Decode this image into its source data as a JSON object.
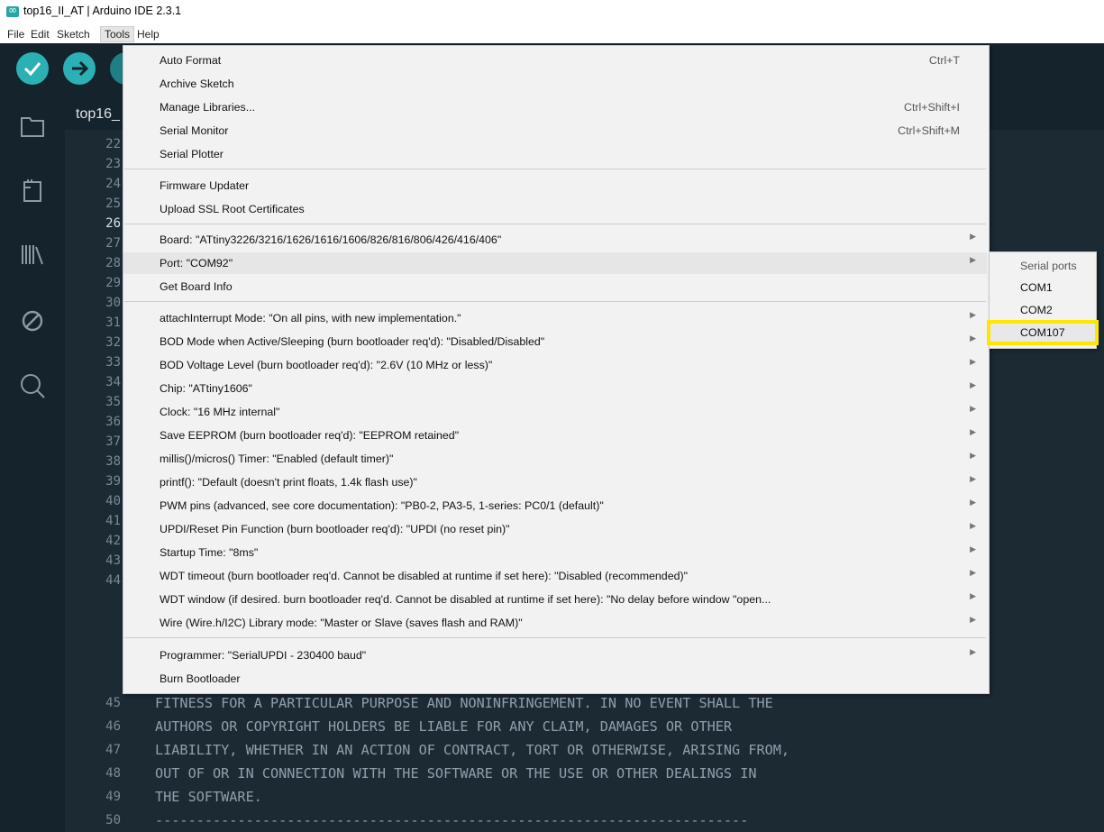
{
  "window": {
    "title": "top16_II_AT | Arduino IDE 2.3.1"
  },
  "menubar": {
    "items": [
      "File",
      "Edit",
      "Sketch",
      "Tools",
      "Help"
    ],
    "active": "Tools"
  },
  "editor": {
    "tab_label": "top16_",
    "current_line": 26,
    "line_numbers": [
      "22",
      "23",
      "24",
      "25",
      "26",
      "27",
      "28",
      "29",
      "30",
      "31",
      "32",
      "33",
      "34",
      "35",
      "36",
      "37",
      "38",
      "39",
      "40",
      "41",
      "42",
      "43",
      "44",
      "45",
      "46",
      "47",
      "48",
      "49",
      "50"
    ],
    "visible_code": [
      "FITNESS FOR A PARTICULAR PURPOSE AND NONINFRINGEMENT. IN NO EVENT SHALL THE",
      "AUTHORS OR COPYRIGHT HOLDERS BE LIABLE FOR ANY CLAIM, DAMAGES OR OTHER",
      "LIABILITY, WHETHER IN AN ACTION OF CONTRACT, TORT OR OTHERWISE, ARISING FROM,",
      "OUT OF OR IN CONNECTION WITH THE SOFTWARE OR THE USE OR OTHER DEALINGS IN",
      "THE SOFTWARE.",
      "------------------------------------------------------------------------"
    ]
  },
  "toolbar": {
    "verify_icon": "checkmark-icon",
    "upload_icon": "arrow-right-icon",
    "debug_icon": "debug-icon"
  },
  "sidebar": {
    "icons": [
      "folder-icon",
      "board-icon",
      "library-icon",
      "debug-icon",
      "search-icon"
    ]
  },
  "tools_menu": {
    "items": [
      {
        "label": "Auto Format",
        "shortcut": "Ctrl+T"
      },
      {
        "label": "Archive Sketch"
      },
      {
        "label": "Manage Libraries...",
        "shortcut": "Ctrl+Shift+I"
      },
      {
        "label": "Serial Monitor",
        "shortcut": "Ctrl+Shift+M"
      },
      {
        "label": "Serial Plotter"
      },
      {
        "label": "Firmware Updater"
      },
      {
        "label": "Upload SSL Root Certificates"
      },
      {
        "label": "Board: \"ATtiny3226/3216/1626/1616/1606/826/816/806/426/416/406\"",
        "submenu": true
      },
      {
        "label": "Port: \"COM92\"",
        "submenu": true,
        "highlighted": true
      },
      {
        "label": "Get Board Info"
      },
      {
        "label": "attachInterrupt Mode: \"On all pins, with new implementation.\"",
        "submenu": true
      },
      {
        "label": "BOD Mode when Active/Sleeping (burn bootloader req'd): \"Disabled/Disabled\"",
        "submenu": true
      },
      {
        "label": "BOD Voltage Level (burn bootloader req'd): \"2.6V (10 MHz or less)\"",
        "submenu": true
      },
      {
        "label": "Chip: \"ATtiny1606\"",
        "submenu": true
      },
      {
        "label": "Clock: \"16 MHz internal\"",
        "submenu": true
      },
      {
        "label": "Save EEPROM (burn bootloader req'd): \"EEPROM retained\"",
        "submenu": true
      },
      {
        "label": "millis()/micros() Timer: \"Enabled (default timer)\"",
        "submenu": true
      },
      {
        "label": "printf(): \"Default (doesn't print floats, 1.4k flash use)\"",
        "submenu": true
      },
      {
        "label": "PWM pins (advanced, see core documentation): \"PB0-2, PA3-5, 1-series: PC0/1 (default)\"",
        "submenu": true
      },
      {
        "label": "UPDI/Reset Pin Function (burn bootloader req'd): \"UPDI (no reset pin)\"",
        "submenu": true
      },
      {
        "label": "Startup Time: \"8ms\"",
        "submenu": true
      },
      {
        "label": "WDT timeout (burn bootloader req'd. Cannot be disabled at runtime if set here): \"Disabled (recommended)\"",
        "submenu": true
      },
      {
        "label": "WDT window (if desired. burn bootloader req'd. Cannot be disabled at runtime if set here): \"No delay before window \"open...",
        "submenu": true
      },
      {
        "label": "Wire (Wire.h/I2C) Library mode: \"Master or Slave (saves flash and RAM)\"",
        "submenu": true
      },
      {
        "label": "Programmer: \"SerialUPDI - 230400 baud\"",
        "submenu": true
      },
      {
        "label": "Burn Bootloader"
      }
    ]
  },
  "port_submenu": {
    "header": "Serial ports",
    "ports": [
      "COM1",
      "COM2",
      "COM107"
    ],
    "highlighted": "COM107",
    "highlight_color": "#ffe600"
  },
  "colors": {
    "accent": "#2bb0b4",
    "editor_bg": "#1c2a34",
    "toolbar_bg": "#15232c"
  }
}
